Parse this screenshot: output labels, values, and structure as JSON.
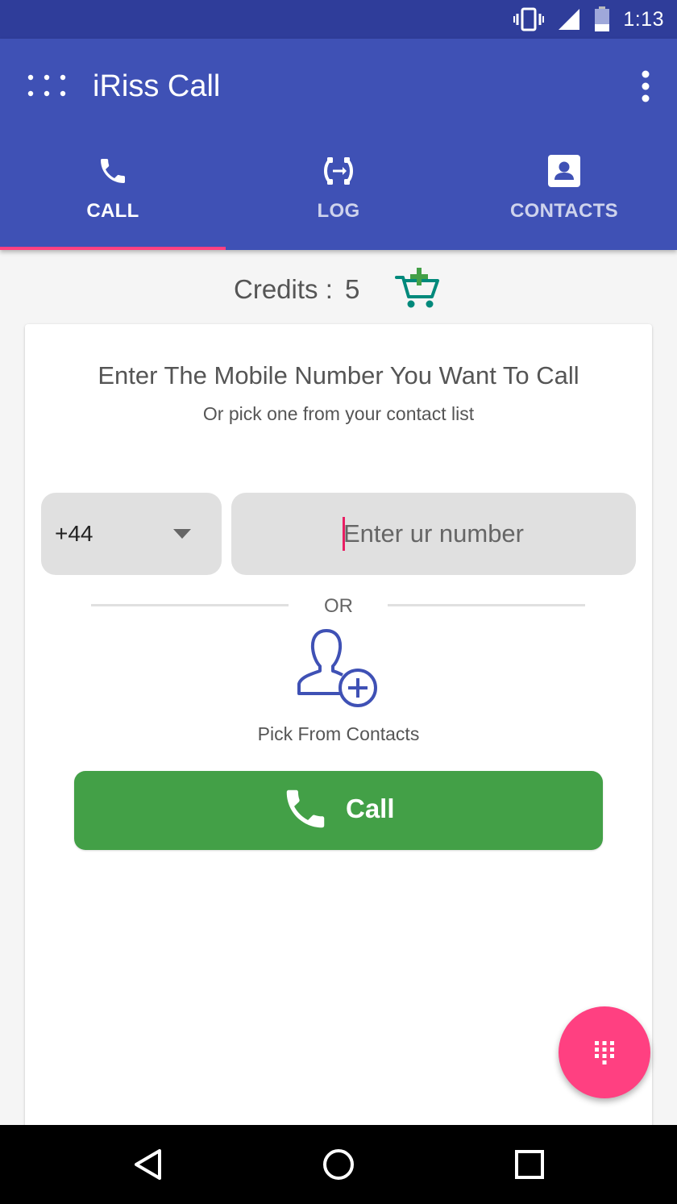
{
  "status_bar": {
    "time": "1:13",
    "icons": [
      "vibrate-icon",
      "signal-icon",
      "battery-icon"
    ]
  },
  "app_bar": {
    "title": "iRiss Call",
    "menu_icon": "grid-menu-icon",
    "overflow_icon": "more-vert-icon"
  },
  "tabs": [
    {
      "label": "CALL",
      "icon": "phone-icon",
      "active": true
    },
    {
      "label": "LOG",
      "icon": "call-log-icon",
      "active": false
    },
    {
      "label": "CONTACTS",
      "icon": "contact-card-icon",
      "active": false
    }
  ],
  "credits": {
    "label": "Credits :",
    "value": "5",
    "icon": "add-cart-icon"
  },
  "card": {
    "title": "Enter The Mobile Number You Want To Call",
    "subtitle": "Or pick one from your contact list",
    "country_code": "+44",
    "number_placeholder": "Enter ur number",
    "number_value": "",
    "or_label": "OR",
    "pick_label": "Pick From Contacts",
    "call_label": "Call"
  },
  "fab": {
    "icon": "dialpad-icon"
  },
  "nav_bar": {
    "buttons": [
      "back-icon",
      "home-icon",
      "recents-icon"
    ]
  },
  "colors": {
    "status_bar": "#2f3d9a",
    "primary": "#3f51b5",
    "accent": "#ff4081",
    "call_green": "#43a047",
    "cart_teal": "#00897b",
    "cart_plus": "#43a047",
    "contact_icon": "#3f51b5"
  }
}
